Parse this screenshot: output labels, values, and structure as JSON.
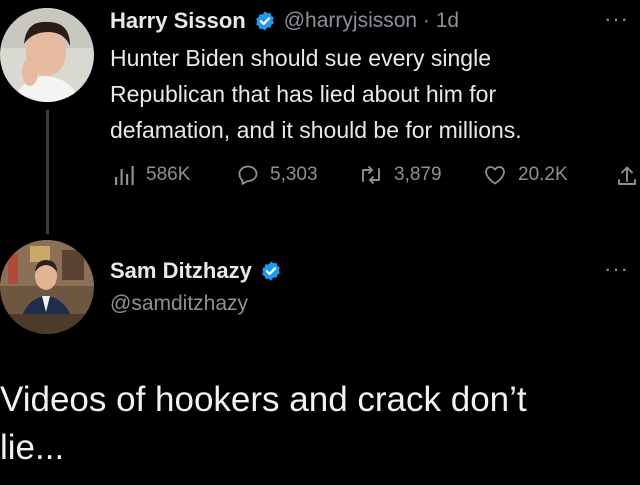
{
  "tweet1": {
    "name": "Harry Sisson",
    "handle_time": "@harryjsisson · 1d",
    "text_lines": [
      "Hunter Biden should sue every single",
      "Republican that has lied about him for",
      "defamation, and it should be for millions."
    ],
    "views": "586K",
    "replies": "5,303",
    "retweets": "3,879",
    "likes": "20.2K",
    "more": "···"
  },
  "tweet2": {
    "name": "Sam Ditzhazy",
    "handle": "@samditzhazy",
    "more": "···",
    "text_lines": [
      "Videos of hookers and crack don’t",
      "lie..."
    ]
  },
  "colors": {
    "background": "#000000",
    "text": "#e7e9ea",
    "muted": "#8b9199",
    "verified": "#1d9bf0"
  }
}
